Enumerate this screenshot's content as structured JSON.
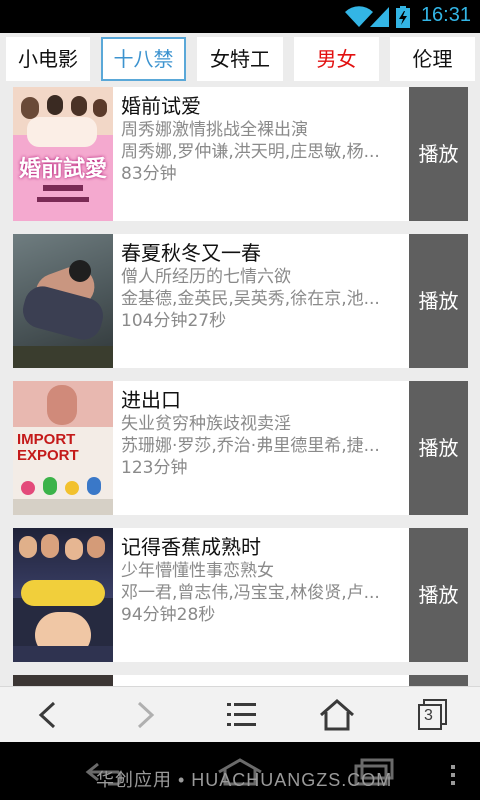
{
  "status": {
    "time": "16:31",
    "battery_icon": "battery-charging-icon",
    "wifi_icon": "wifi-icon",
    "signal_icon": "signal-icon",
    "accent": "#33b5e5"
  },
  "tabs": [
    {
      "label": "小电影",
      "active": false
    },
    {
      "label": "十八禁",
      "active": true
    },
    {
      "label": "女特工",
      "active": false
    },
    {
      "label": "男女",
      "active": false,
      "color": "#e21010"
    },
    {
      "label": "伦理",
      "active": false
    }
  ],
  "movies": [
    {
      "title": "婚前试爱",
      "tagline": "周秀娜激情挑战全裸出演",
      "cast": "周秀娜,罗仲谦,洪天明,庄思敏,杨...",
      "duration": "83分钟",
      "play_label": "播放",
      "poster_text": "婚前試愛"
    },
    {
      "title": "春夏秋冬又一春",
      "tagline": "僧人所经历的七情六欲",
      "cast": "金基德,金英民,吴英秀,徐在京,池...",
      "duration": "104分钟27秒",
      "play_label": "播放"
    },
    {
      "title": "进出口",
      "tagline": "失业贫穷种族歧视卖淫",
      "cast": "苏珊娜·罗莎,乔治·弗里德里希,捷...",
      "duration": "123分钟",
      "play_label": "播放",
      "poster_text_1": "IMPORT",
      "poster_text_2": "EXPORT"
    },
    {
      "title": "记得香蕉成熟时",
      "tagline": "少年懵懂性事恋熟女",
      "cast": "邓一君,曾志伟,冯宝宝,林俊贤,卢...",
      "duration": "94分钟28秒",
      "play_label": "播放"
    },
    {
      "title": "",
      "tagline": "",
      "cast": "",
      "duration": "",
      "play_label": ""
    }
  ],
  "navbar": {
    "badge_count": "3"
  },
  "watermark": "华创应用 • HUACHUANGZS.COM"
}
